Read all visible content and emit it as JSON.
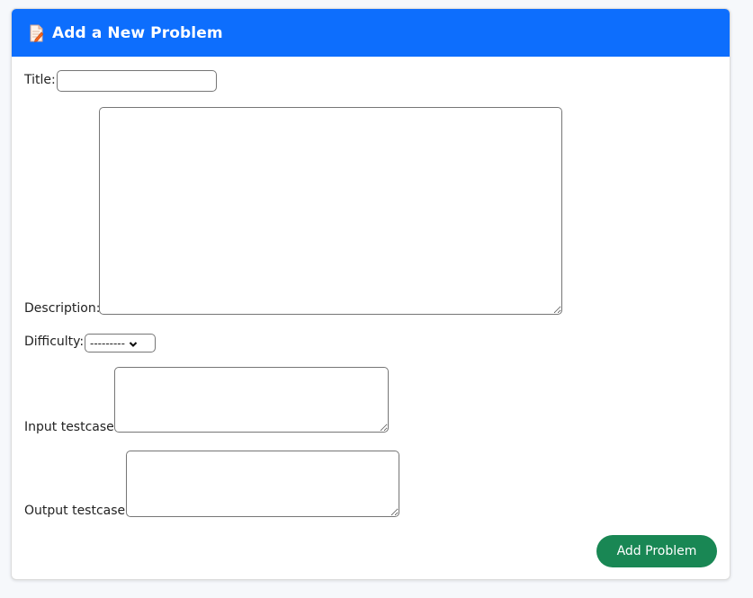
{
  "header": {
    "title": "Add a New Problem",
    "icon": "memo-icon",
    "accent_color": "#0d6efd"
  },
  "form": {
    "title_label": "Title:",
    "title_value": "",
    "description_label": "Description:",
    "description_value": "",
    "difficulty_label": "Difficulty:",
    "difficulty_selected": "---------",
    "input_testcase_label": "Input testcase:",
    "input_testcase_value": "",
    "output_testcase_label": "Output testcase:",
    "output_testcase_value": "",
    "submit_label": "Add Problem",
    "submit_color": "#198754"
  }
}
